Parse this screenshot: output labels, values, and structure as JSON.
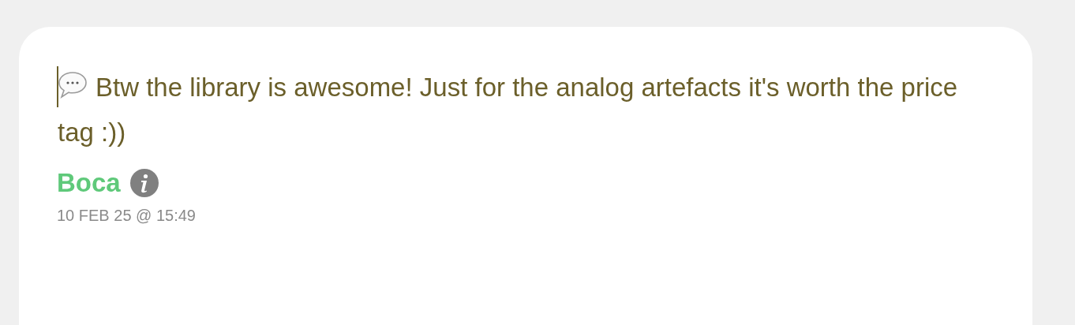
{
  "review": {
    "text": "Btw the library is awesome! Just for the analog artefacts it's worth the price tag :))",
    "author": "Boca",
    "date": "10 FEB 25 @ 15:49"
  }
}
